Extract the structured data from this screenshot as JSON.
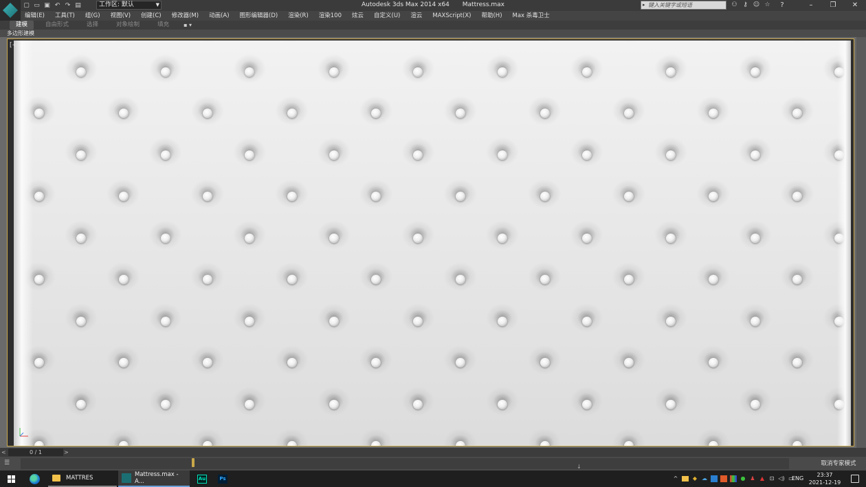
{
  "title_bar": {
    "app_name": "Autodesk 3ds Max  2014 x64",
    "file_name": "Mattress.max",
    "workspace_label": "工作区: 默认",
    "search_placeholder": "键入关键字或短语",
    "help_label": "?"
  },
  "quick_access": [
    "new",
    "open",
    "save",
    "undo",
    "redo",
    "project"
  ],
  "menu": [
    "编辑(E)",
    "工具(T)",
    "组(G)",
    "视图(V)",
    "创建(C)",
    "修改器(M)",
    "动画(A)",
    "图形编辑器(D)",
    "渲染(R)",
    "渲染100",
    "炫云",
    "自定义(U)",
    "渲云",
    "MAXScript(X)",
    "帮助(H)",
    "Max 杀毒卫士"
  ],
  "ribbon": {
    "tabs": [
      "建模",
      "自由形式",
      "选择",
      "对象绘制",
      "填充"
    ],
    "active": "建模",
    "extra": "▪ ▾"
  },
  "subbar": {
    "label": "多边形建模"
  },
  "viewport": {
    "corner_label": "[+"
  },
  "time_slider": {
    "prev": "<",
    "frame": "0 / 1",
    "next": ">"
  },
  "track_bar": {
    "status": "取消专家模式"
  },
  "taskbar": {
    "explorer_label": "MATTRES",
    "max_label": "Mattress.max - A...",
    "au_label": "Au",
    "ps_label": "Ps",
    "lang": "ENG",
    "time": "23:37",
    "date": "2021-12-19"
  },
  "colors": {
    "accent_frame": "#c9a84a",
    "taskbar_active": "#6aa0d8"
  }
}
